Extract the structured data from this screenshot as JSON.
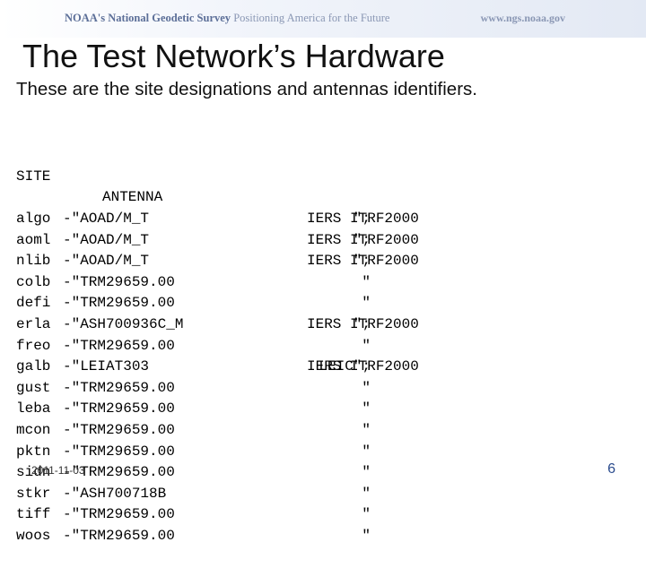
{
  "banner": {
    "org": "NOAA's National Geodetic Survey",
    "tagline": "Positioning America for the Future",
    "url": "www.ngs.noaa.gov"
  },
  "title": "The Test Network’s Hardware",
  "subtitle": "These are the site designations and antennas identifiers.",
  "table": {
    "header_site": "SITE",
    "header_antenna": "ANTENNA",
    "rows": [
      {
        "site": "algo",
        "antenna": "-\"AOAD/M_T",
        "radome": "\";",
        "ref": "IERS ITRF2000"
      },
      {
        "site": "aoml",
        "antenna": "-\"AOAD/M_T",
        "radome": "\";",
        "ref": "IERS ITRF2000"
      },
      {
        "site": "nlib",
        "antenna": "-\"AOAD/M_T",
        "radome": "\";",
        "ref": "IERS ITRF2000"
      },
      {
        "site": "colb",
        "antenna": "-\"TRM29659.00",
        "radome": "\"",
        "ref": ""
      },
      {
        "site": "defi",
        "antenna": "-\"TRM29659.00",
        "radome": "\"",
        "ref": ""
      },
      {
        "site": "erla",
        "antenna": "-\"ASH700936C_M",
        "radome": "\";",
        "ref": "IERS ITRF2000"
      },
      {
        "site": "freo",
        "antenna": "-\"TRM29659.00",
        "radome": "\"",
        "ref": ""
      },
      {
        "site": "galb",
        "antenna": "-\"LEIAT303",
        "radome": "LEIC\";",
        "ref": "IERS ITRF2000"
      },
      {
        "site": "gust",
        "antenna": "-\"TRM29659.00",
        "radome": "\"",
        "ref": ""
      },
      {
        "site": "leba",
        "antenna": "-\"TRM29659.00",
        "radome": "\"",
        "ref": ""
      },
      {
        "site": "mcon",
        "antenna": "-\"TRM29659.00",
        "radome": "\"",
        "ref": ""
      },
      {
        "site": "pktn",
        "antenna": "-\"TRM29659.00",
        "radome": "\"",
        "ref": ""
      },
      {
        "site": "sidn",
        "antenna": "-\"TRM29659.00",
        "radome": "\"",
        "ref": ""
      },
      {
        "site": "stkr",
        "antenna": "-\"ASH700718B",
        "radome": "\"",
        "ref": ""
      },
      {
        "site": "tiff",
        "antenna": "-\"TRM29659.00",
        "radome": "\"",
        "ref": ""
      },
      {
        "site": "woos",
        "antenna": "-\"TRM29659.00",
        "radome": "\"",
        "ref": ""
      }
    ]
  },
  "footer": {
    "date": "2011-11-03",
    "page_number": "6"
  }
}
